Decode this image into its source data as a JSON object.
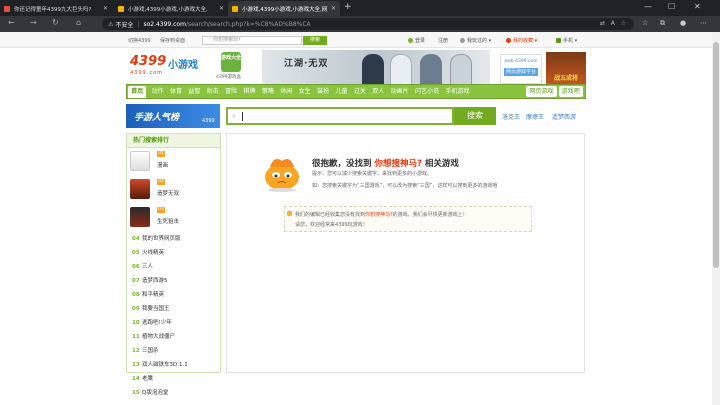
{
  "browser": {
    "tabs": [
      {
        "title": "你还记得童年4399九大巨头吗?",
        "active": false
      },
      {
        "title": "小游戏,4399小游戏,小游戏大全,",
        "active": false
      },
      {
        "title": "小游戏,4399小游戏,小游戏大全,网页游戏",
        "active": true
      }
    ],
    "new_tab": "+",
    "address": {
      "security": "不安全",
      "host": "so2.4399.com",
      "path": "/search/search.php?k=%C8%AD%B8%CA"
    }
  },
  "site": {
    "top_strip": {
      "link1": "切换4399",
      "link2": "保存到桌面",
      "search_placeholder": "你想搜哪玩?",
      "search_button": "搜索",
      "login": "登录",
      "register": "注册",
      "history": "我玩过的",
      "favorites": "我的收藏",
      "mobile": "手机"
    },
    "logo": {
      "main": "4399",
      "sub": "小游戏",
      "url": "4399.com"
    },
    "logo2": {
      "box": "游戏大全",
      "caption": "4399游戏盒"
    },
    "banner_text": "江湖·无双",
    "ad1": {
      "top": "web.4399.com",
      "btn": "网页游戏平台"
    },
    "ad2": {
      "text": "战五成将"
    },
    "nav": {
      "home": "首页",
      "items": [
        "动作",
        "体育",
        "益智",
        "射击",
        "冒险",
        "棋牌",
        "策略",
        "休闲",
        "女生",
        "装扮",
        "儿童",
        "过关",
        "双人",
        "动画片",
        "闪艺小说",
        "手机游戏"
      ],
      "right": [
        "网页游戏",
        "游戏吧"
      ]
    },
    "mobile_banner": {
      "title": "手游人气榜",
      "brand": "4399"
    },
    "search": {
      "button": "搜索",
      "hot": [
        "洛克王",
        "摩擦王",
        "造梦西游"
      ]
    },
    "rank": {
      "title": "热门搜索排行",
      "top": [
        {
          "badge": "01",
          "name": "漫画"
        },
        {
          "badge": "02",
          "name": "造梦无双"
        },
        {
          "badge": "03",
          "name": "生死狙击"
        }
      ],
      "items": [
        {
          "no": "04",
          "name": "我的世界网页版"
        },
        {
          "no": "05",
          "name": "火线精英"
        },
        {
          "no": "06",
          "name": "三人"
        },
        {
          "no": "07",
          "name": "造梦西游5"
        },
        {
          "no": "08",
          "name": "和平精英"
        },
        {
          "no": "09",
          "name": "我要当国王"
        },
        {
          "no": "10",
          "name": "逃跑吧!少年"
        },
        {
          "no": "11",
          "name": "植物大战僵尸"
        },
        {
          "no": "12",
          "name": "三国杀"
        },
        {
          "no": "13",
          "name": "双人磁铁车3D.1.1"
        },
        {
          "no": "14",
          "name": "老鹰"
        },
        {
          "no": "15",
          "name": "Q版泡泡堂"
        }
      ]
    },
    "result": {
      "sorry_prefix": "很抱歉，没找到",
      "keyword_label": "你想搜神马?",
      "sorry_suffix": "相关游戏",
      "tip1": "提示：您可以减少搜索关键字，来找到更多的小游戏。",
      "tip2": "如：您搜索关键字为“三国游戏”，可以改为搜索“三国”，这样可以搜到更多的游戏哦",
      "note_prefix": "我们的编辑已经收集您没有找到",
      "note_keyword": "你想搜神马?",
      "note_suffix": "的游戏，我们会尽快更新游戏上！",
      "note_line2": "请您，欢迎经常来4399玩游戏！"
    }
  }
}
